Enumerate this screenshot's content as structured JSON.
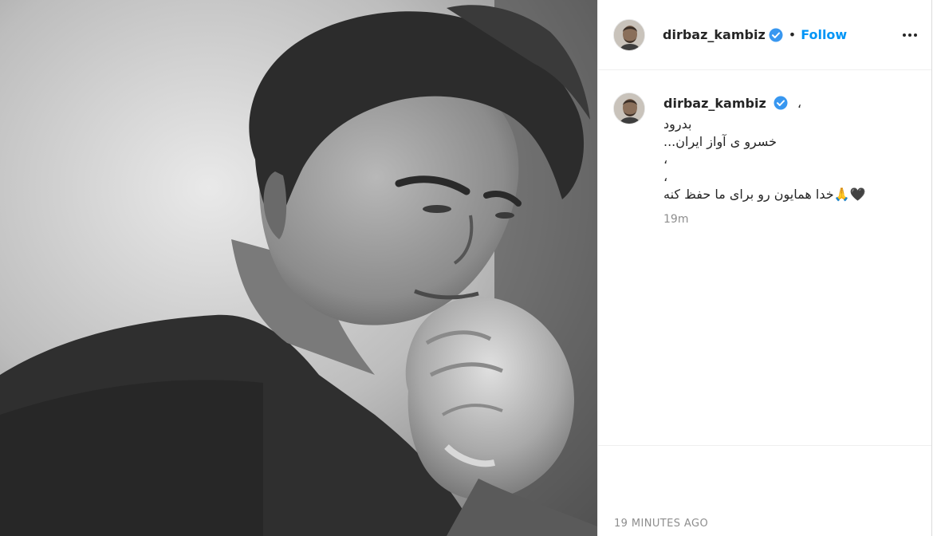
{
  "post": {
    "image_alt": "Black and white portrait photo of a man resting his chin on his clasped hands",
    "username": "dirbaz_kambiz",
    "header_separator": "•",
    "follow_label": "Follow",
    "more_icon": "more-options-icon",
    "verified_icon": "verified-badge-icon",
    "caption": {
      "name_suffix": "،",
      "lines": "بدرود\n...خسرو ی آواز ایران\n،\n،\nخدا همایون رو برای ما حفظ کنه🙏🖤",
      "time": "19m"
    },
    "timestamp": "19 MINUTES AGO"
  },
  "colors": {
    "link": "#0095f6",
    "text": "#262626",
    "muted": "#8e8e8e",
    "verified": "#3897f0"
  }
}
